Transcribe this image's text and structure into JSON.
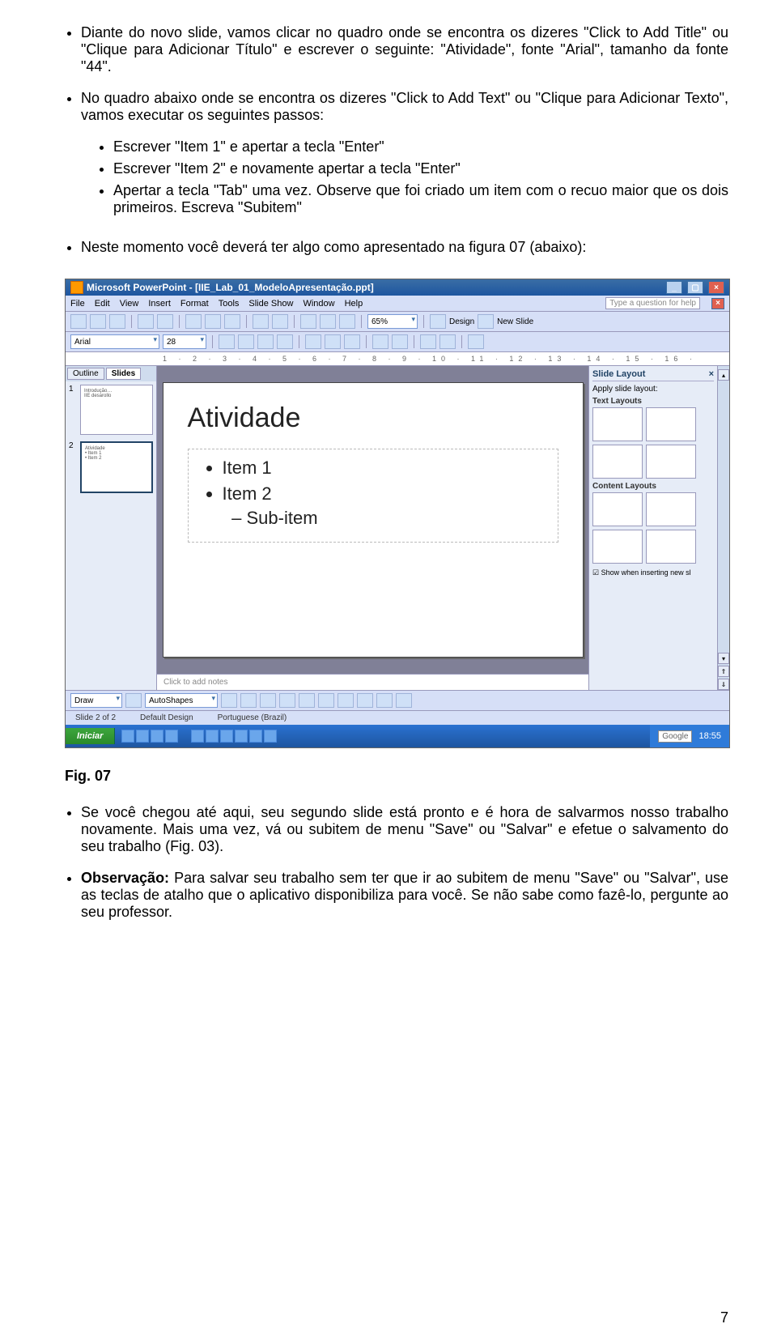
{
  "doc": {
    "p1": "Diante do novo slide, vamos clicar no quadro onde se encontra os dizeres \"Click to Add Title\" ou \"Clique para Adicionar Título\" e escrever o seguinte: \"Atividade\", fonte \"Arial\", tamanho da fonte \"44\".",
    "p2": "No quadro abaixo onde se encontra os dizeres \"Click to Add Text\" ou \"Clique para Adicionar Texto\", vamos executar os seguintes passos:",
    "sub1": "Escrever \"Item 1\" e apertar a tecla \"Enter\"",
    "sub2": "Escrever \"Item 2\" e novamente apertar a tecla \"Enter\"",
    "sub3": "Apertar a tecla \"Tab\" uma vez. Observe que foi criado um item com o recuo maior que os dois primeiros. Escreva \"Subitem\"",
    "p3": "Neste momento você deverá ter algo como apresentado na figura 07 (abaixo):",
    "fig": "Fig. 07",
    "p4": "Se você chegou até aqui, seu segundo slide está pronto e é hora de salvarmos nosso trabalho novamente. Mais uma vez, vá ou subitem de menu \"Save\" ou \"Salvar\" e efetue o salvamento do seu trabalho (Fig. 03).",
    "obs_label": "Observação:",
    "obs_body": " Para salvar seu trabalho sem ter que ir ao subitem de menu \"Save\" ou \"Salvar\", use as teclas de atalho que o aplicativo disponibiliza para você. Se não sabe como fazê-lo, pergunte ao seu professor.",
    "pagenum": "7"
  },
  "pp": {
    "title": "Microsoft PowerPoint - [IIE_Lab_01_ModeloApresentação.ppt]",
    "menu": [
      "File",
      "Edit",
      "View",
      "Insert",
      "Format",
      "Tools",
      "Slide Show",
      "Window",
      "Help"
    ],
    "helpbox": "Type a question for help",
    "zoom": "65%",
    "design": "Design",
    "newslide": "New Slide",
    "font": "Arial",
    "fontsize": "28",
    "ruler": "1 · 2 · 3 · 4 · 5 · 6 · 7 · 8 · 9 · 10 · 11 · 12 · 13 · 14 · 15 · 16 ·",
    "tabs": {
      "outline": "Outline",
      "slides": "Slides"
    },
    "slide": {
      "title": "Atividade",
      "item1": "Item 1",
      "item2": "Item 2",
      "sub": "Sub-item"
    },
    "notes": "Click to add notes",
    "rp": {
      "title": "Slide Layout",
      "apply": "Apply slide layout:",
      "sec1": "Text Layouts",
      "sec2": "Content Layouts",
      "check": "Show when inserting new sl"
    },
    "draw": {
      "draw_label": "Draw",
      "autoshapes": "AutoShapes"
    },
    "status": {
      "slide": "Slide 2 of 2",
      "design": "Default Design",
      "lang": "Portuguese (Brazil)"
    },
    "task": {
      "start": "Iniciar",
      "google": "Google",
      "time": "18:55"
    }
  }
}
